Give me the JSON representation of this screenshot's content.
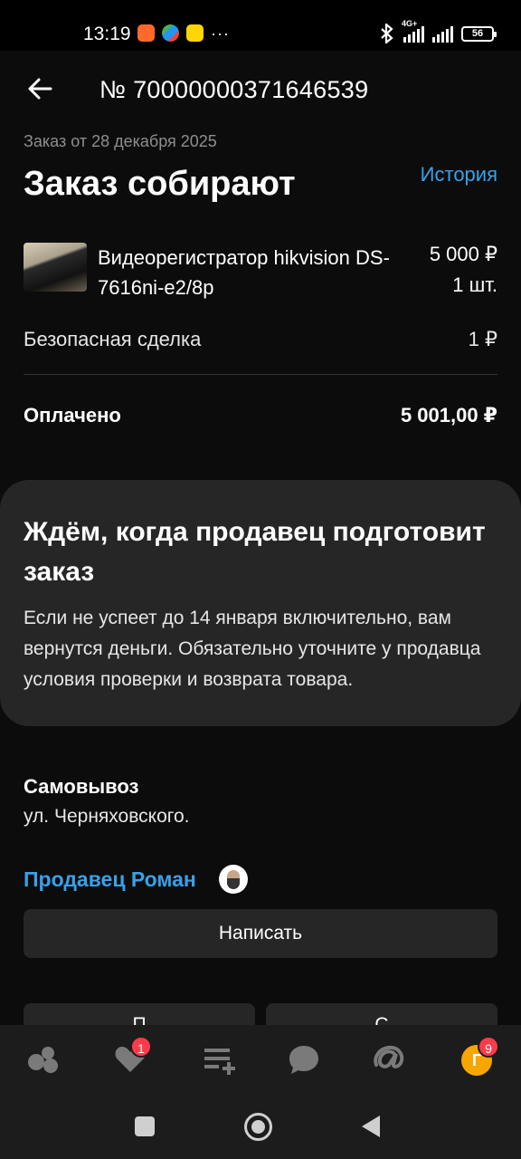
{
  "status_bar": {
    "time": "13:19",
    "network_label": "4G+",
    "battery": "56",
    "dots": "···"
  },
  "header": {
    "order_number": "№ 70000000371646539"
  },
  "order": {
    "date": "Заказ от 28 декабря 2025",
    "status": "Заказ собирают",
    "history_link": "История"
  },
  "product": {
    "name": "Видеорегистратор hikvision DS-7616ni-e2/8p",
    "price": "5 000 ₽",
    "quantity": "1 шт."
  },
  "safe_deal": {
    "label": "Безопасная сделка",
    "price": "1 ₽"
  },
  "paid": {
    "label": "Оплачено",
    "value": "5 001,00 ₽"
  },
  "info_card": {
    "title": "Ждём, когда продавец подготовит заказ",
    "text": "Если не успеет до 14 января включительно, вам вернутся деньги. Обязательно уточните у продавца условия проверки и возврата товара."
  },
  "delivery": {
    "method": "Самовывоз",
    "address": "ул. Черняховского."
  },
  "seller": {
    "link": "Продавец Роман",
    "write_button": "Написать",
    "btn_left_partial": "П",
    "btn_right_partial": "С"
  },
  "bottom_nav": {
    "favorites_badge": "1",
    "profile_badge": "9",
    "profile_initial": "Г",
    "accent_color": "#3aa0e8",
    "badge_color": "#ff3b4b"
  }
}
